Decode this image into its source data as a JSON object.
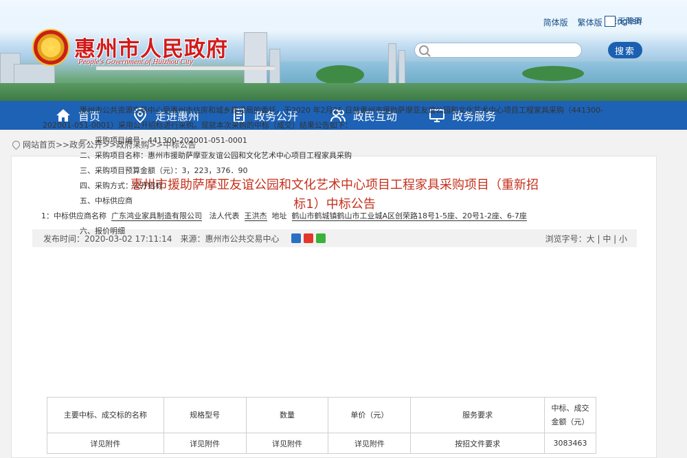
{
  "header": {
    "title": "惠州市人民政府",
    "subtitle": "People's Government of Huizhou City",
    "links": [
      "简体版",
      "繁体版",
      "English"
    ],
    "accessible_label": "无障碍",
    "search_placeholder": "",
    "search_button": "搜索"
  },
  "nav": {
    "items": [
      {
        "label": "首页",
        "icon": "home-icon"
      },
      {
        "label": "走进惠州",
        "icon": "location-pin-icon"
      },
      {
        "label": "政务公开",
        "icon": "document-icon"
      },
      {
        "label": "政民互动",
        "icon": "people-icon"
      },
      {
        "label": "政务服务",
        "icon": "monitor-icon"
      }
    ]
  },
  "breadcrumb": "网站首页>>政务公开>>政府采购>>中标公告",
  "article": {
    "title_line1": "惠州市援助萨摩亚友谊公园和文化艺术中心项目工程家具采购项目（重新招",
    "title_line2": "标1）中标公告",
    "publish_time": "发布时间：2020-03-02 17:11:14",
    "source": "来源：惠州市公共交易中心",
    "font_size": "浏览字号：大 | 中 | 小",
    "para1": "惠州市公共资源交易中心受惠州市住房和城乡建设局的委托，于2020 年2月25 日就惠州市援助萨摩亚友谊公园和文化艺术中心项目工程家具采购（441300-202001-051-0001）采用公开招标进行采购。现就本次采购的中标（成交）结果公告如下：",
    "item1": "一、采购项目编号：441300-202001-051-0001",
    "item2": "二、采购项目名称：惠州市援助萨摩亚友谊公园和文化艺术中心项目工程家具采购",
    "item3": "三、采购项目预算金额（元）：3，223，376．90",
    "item4": "四、采购方式：公开招标",
    "item5": "五、中标供应商",
    "supplier_prefix": "1：中标供应商名称",
    "supplier_name": "广东鸿业家具制造有限公司",
    "legal_label": "法人代表",
    "legal_name": "王洪杰",
    "address_label": "地址",
    "address": "鹤山市鹤城镇鹤山市工业城A区创荣路18号1-5座、20号1-2座、6-7座",
    "item6": "六、报价明细"
  },
  "table": {
    "headers": [
      "主要中标、成交标的名称",
      "规格型号",
      "数量",
      "单价（元）",
      "服务要求",
      "中标、成交金额（元）"
    ],
    "rows": [
      [
        "详见附件",
        "详见附件",
        "详见附件",
        "详见附件",
        "按招文件要求",
        "3083463"
      ]
    ]
  },
  "colors": {
    "nav_bg": "#1d62b5",
    "title_red": "#c4311d",
    "brand_red": "#d11a1a"
  }
}
